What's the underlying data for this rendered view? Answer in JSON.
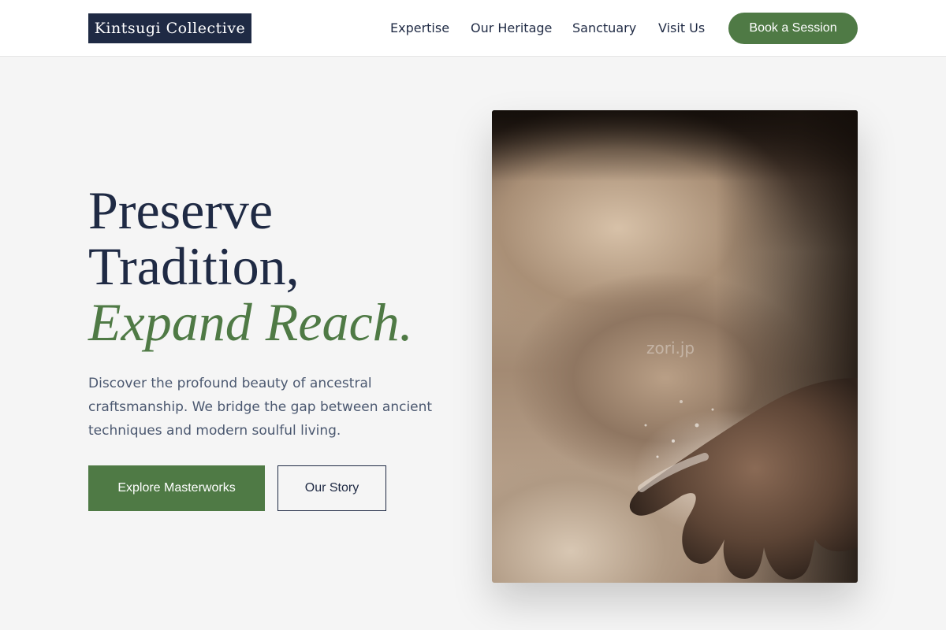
{
  "header": {
    "logo": "Kintsugi Collective",
    "nav": [
      {
        "label": "Expertise"
      },
      {
        "label": "Our Heritage"
      },
      {
        "label": "Sanctuary"
      },
      {
        "label": "Visit Us"
      }
    ],
    "cta_label": "Book a Session"
  },
  "hero": {
    "title_line1": "Preserve",
    "title_line2": "Tradition,",
    "title_accent": "Expand Reach.",
    "description": "Discover the profound beauty of ancestral craftsmanship. We bridge the gap between ancient techniques and modern soulful living.",
    "primary_button": "Explore Masterworks",
    "secondary_button": "Our Story",
    "image_watermark": "zori.jp"
  },
  "colors": {
    "brand_navy": "#1f2a44",
    "accent_green": "#4f7a45",
    "background": "#f5f5f5"
  }
}
